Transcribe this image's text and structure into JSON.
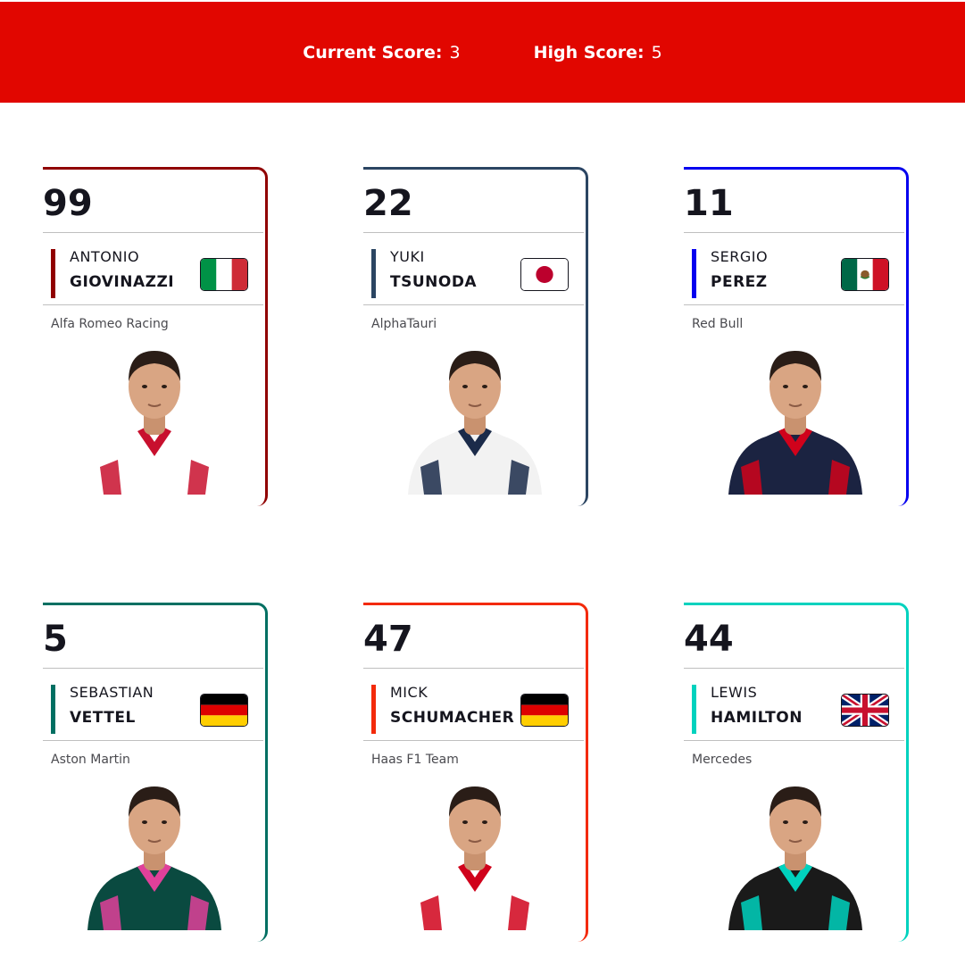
{
  "header": {
    "current_score_label": "Current Score:",
    "current_score_value": "3",
    "high_score_label": "High Score:",
    "high_score_value": "5",
    "color": "#e10600"
  },
  "cards": [
    {
      "number": "99",
      "first": "ANTONIO",
      "last": "GIOVINAZZI",
      "team": "Alfa Romeo Racing",
      "team_color": "#900000",
      "flag": "flag-italy-icon",
      "suit": "#ffffff",
      "suit_trim": "#c8102e"
    },
    {
      "number": "22",
      "first": "YUKI",
      "last": "TSUNODA",
      "team": "AlphaTauri",
      "team_color": "#2b4562",
      "flag": "flag-japan-icon",
      "suit": "#f2f2f2",
      "suit_trim": "#1b2b4a"
    },
    {
      "number": "11",
      "first": "SERGIO",
      "last": "PEREZ",
      "team": "Red Bull",
      "team_color": "#0600ef",
      "flag": "flag-mexico-icon",
      "suit": "#1b2341",
      "suit_trim": "#d0021b"
    },
    {
      "number": "5",
      "first": "SEBASTIAN",
      "last": "VETTEL",
      "team": "Aston Martin",
      "team_color": "#006f62",
      "flag": "flag-germany-icon",
      "suit": "#0a4a40",
      "suit_trim": "#e0409a"
    },
    {
      "number": "47",
      "first": "MICK",
      "last": "SCHUMACHER",
      "team": "Haas F1 Team",
      "team_color": "#f32a0a",
      "flag": "flag-germany-icon",
      "suit": "#ffffff",
      "suit_trim": "#d0021b"
    },
    {
      "number": "44",
      "first": "LEWIS",
      "last": "HAMILTON",
      "team": "Mercedes",
      "team_color": "#00d2be",
      "flag": "flag-uk-icon",
      "suit": "#1a1a1a",
      "suit_trim": "#00d2be"
    }
  ]
}
